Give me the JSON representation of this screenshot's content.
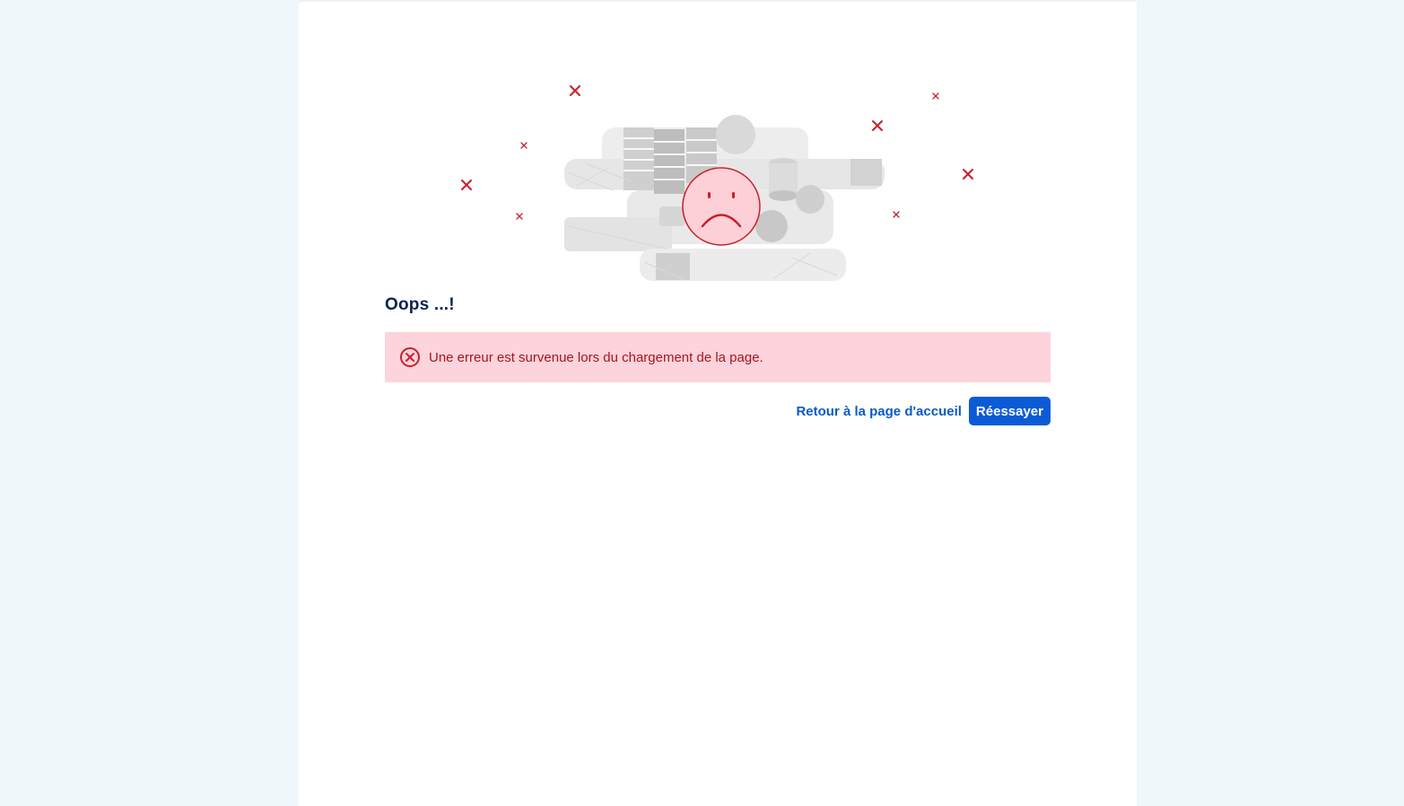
{
  "error_page": {
    "title": "Oops ...!",
    "alert": {
      "message": "Une erreur est survenue lors du chargement de la page.",
      "icon": "error-circle-x-icon",
      "background_color": "#fdd3dc",
      "text_color": "#a5161b"
    },
    "actions": {
      "home_link_label": "Retour à la page d'accueil",
      "retry_button_label": "Réessayer"
    },
    "illustration": {
      "icon": "sad-face-icon",
      "decoration": "isometric-city-illustration"
    }
  },
  "colors": {
    "accent": "#0b5bd7",
    "title": "#0a2352",
    "error": "#c8202a",
    "background": "#f0f7fb"
  }
}
